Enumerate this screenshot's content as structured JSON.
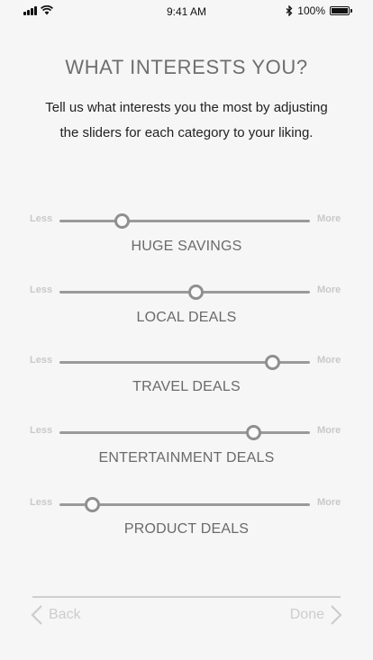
{
  "status_bar": {
    "time": "9:41 AM",
    "battery": "100%"
  },
  "header": {
    "title": "WHAT INTERESTS YOU?",
    "subtitle": "Tell us what interests you the most by adjusting the sliders for each category to your liking."
  },
  "sliders": {
    "less_label": "Less",
    "more_label": "More",
    "items": [
      {
        "label": "HUGE SAVINGS",
        "value": 0.25
      },
      {
        "label": "LOCAL DEALS",
        "value": 0.545
      },
      {
        "label": "TRAVEL DEALS",
        "value": 0.85
      },
      {
        "label": "ENTERTAINMENT DEALS",
        "value": 0.775
      },
      {
        "label": "PRODUCT DEALS",
        "value": 0.13
      }
    ]
  },
  "nav": {
    "back_label": "Back",
    "done_label": "Done"
  },
  "colors": {
    "background": "#f6f6f6",
    "track": "#9a9a9a",
    "muted_text": "#cdcdcd"
  }
}
